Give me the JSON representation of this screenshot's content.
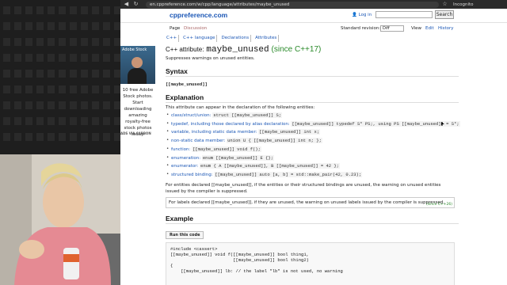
{
  "browser": {
    "url": "en.cppreference.com/w/cpp/language/attributes/maybe_unused",
    "incognito_label": "Incognito"
  },
  "site": {
    "logo": "cppreference.com",
    "login": "Log in",
    "search_button": "Search",
    "nav": {
      "page": "Page",
      "discussion": "Discussion",
      "view": "View",
      "edit": "Edit",
      "history": "History"
    },
    "standard_revision_label": "Standard revision:",
    "standard_revision_value": "Diff"
  },
  "breadcrumbs": [
    "C++",
    "C++ language",
    "Declarations",
    "Attributes"
  ],
  "ad": {
    "title": "Adobe Stock",
    "text": "10 free Adobe Stock photos. Start downloading amazing royalty-free stock photos today.",
    "via": "ADS VIA CARBON"
  },
  "article": {
    "title_prefix": "C++ attribute:",
    "title_main": "maybe_unused",
    "title_since": "(since C++17)",
    "summary": "Suppresses warnings on unused entities.",
    "syntax_heading": "Syntax",
    "syntax_text": "[[maybe_unused]]",
    "explanation_heading": "Explanation",
    "explanation_intro": "This attribute can appear in the declaration of the following entities:",
    "entities": [
      {
        "label": "class/struct/union:",
        "code": "struct [[maybe_unused]] S;"
      },
      {
        "label": "typedef, including those declared by alias declaration:",
        "code": "[[maybe_unused]] typedef S* PS;, using PS [[maybe_unused]] = S*;"
      },
      {
        "label": "variable, including static data member:",
        "code": "[[maybe_unused]] int x;"
      },
      {
        "label": "non-static data member:",
        "code": "union U { [[maybe_unused]] int n; };"
      },
      {
        "label": "function:",
        "code": "[[maybe_unused]] void f();"
      },
      {
        "label": "enumeration:",
        "code": "enum [[maybe_unused]] E {};"
      },
      {
        "label": "enumerator:",
        "code": "enum { A [[maybe_unused]], B [[maybe_unused]] = 42 };"
      },
      {
        "label": "structured binding:",
        "code": "[[maybe_unused]] auto [a, b] = std::make_pair(42, 0.23);"
      }
    ],
    "para_entities": "For entities declared [[maybe_unused]], if the entities or their structured bindings are unused, the warning on unused entities issued by the compiler is suppressed.",
    "para_labels": "For labels declared [[maybe_unused]], if they are unused, the warning on unused labels issued by the compiler is suppressed.",
    "para_labels_since": "(since C++26)",
    "example_heading": "Example",
    "run_button": "Run this code",
    "code_lines": [
      "#include <cassert>",
      "",
      "[[maybe_unused]] void f([[maybe_unused]] bool thing1,",
      "                        [[maybe_unused]] bool thing2)",
      "{",
      "    [[maybe_unused]] lb: // the label \"lb\" is not used, no warning"
    ]
  }
}
